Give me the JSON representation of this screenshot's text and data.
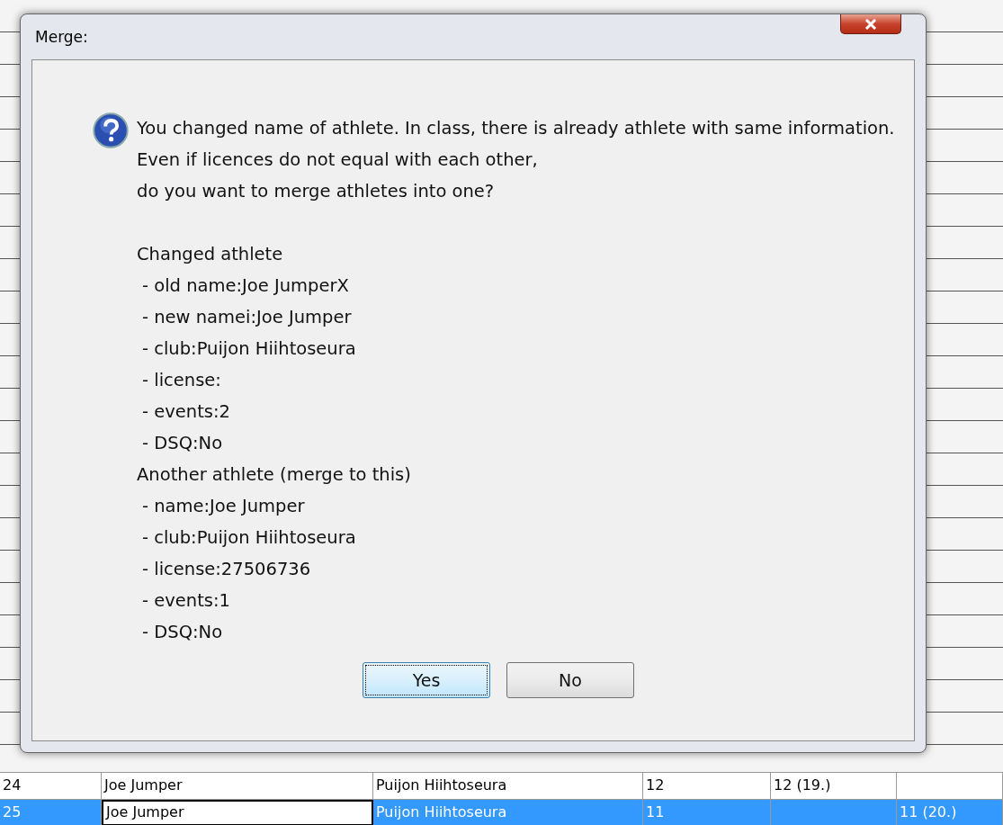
{
  "dialog": {
    "title": "Merge:",
    "message": [
      "You changed name of athlete. In class, there is already athlete with same information.",
      "Even if licences do not equal with each other,",
      "do you want to merge athletes into one?"
    ],
    "details": [
      {
        "text": "Changed athlete",
        "kind": "heading"
      },
      {
        "text": "- old name:Joe JumperX",
        "kind": "item"
      },
      {
        "text": "- new namei:Joe Jumper",
        "kind": "item"
      },
      {
        "text": "- club:Puijon Hiihtoseura",
        "kind": "item"
      },
      {
        "text": "- license:",
        "kind": "item"
      },
      {
        "text": "- events:2",
        "kind": "item"
      },
      {
        "text": "- DSQ:No",
        "kind": "item"
      },
      {
        "text": "Another athlete (merge to this)",
        "kind": "heading"
      },
      {
        "text": "- name:Joe Jumper",
        "kind": "item"
      },
      {
        "text": "- club:Puijon Hiihtoseura",
        "kind": "item"
      },
      {
        "text": "- license:27506736",
        "kind": "item"
      },
      {
        "text": "- events:1",
        "kind": "item"
      },
      {
        "text": "- DSQ:No",
        "kind": "item"
      }
    ],
    "buttons": [
      {
        "label": "Yes",
        "default": true
      },
      {
        "label": "No",
        "default": false
      }
    ]
  },
  "table": {
    "rows": [
      {
        "selected": false,
        "cells": [
          {
            "text": "24",
            "editing": false
          },
          {
            "text": "Joe Jumper",
            "editing": false
          },
          {
            "text": "Puijon Hiihtoseura",
            "editing": false
          },
          {
            "text": "12",
            "editing": false
          },
          {
            "text": "12 (19.)",
            "editing": false
          },
          {
            "editing": false
          }
        ]
      },
      {
        "selected": true,
        "cells": [
          {
            "text": "25",
            "editing": false
          },
          {
            "text": "Joe Jumper",
            "editing": true
          },
          {
            "text": "Puijon Hiihtoseura",
            "editing": false
          },
          {
            "text": "11",
            "editing": false
          },
          {
            "editing": false
          },
          {
            "text": "11 (20.)",
            "editing": false
          }
        ]
      }
    ]
  }
}
